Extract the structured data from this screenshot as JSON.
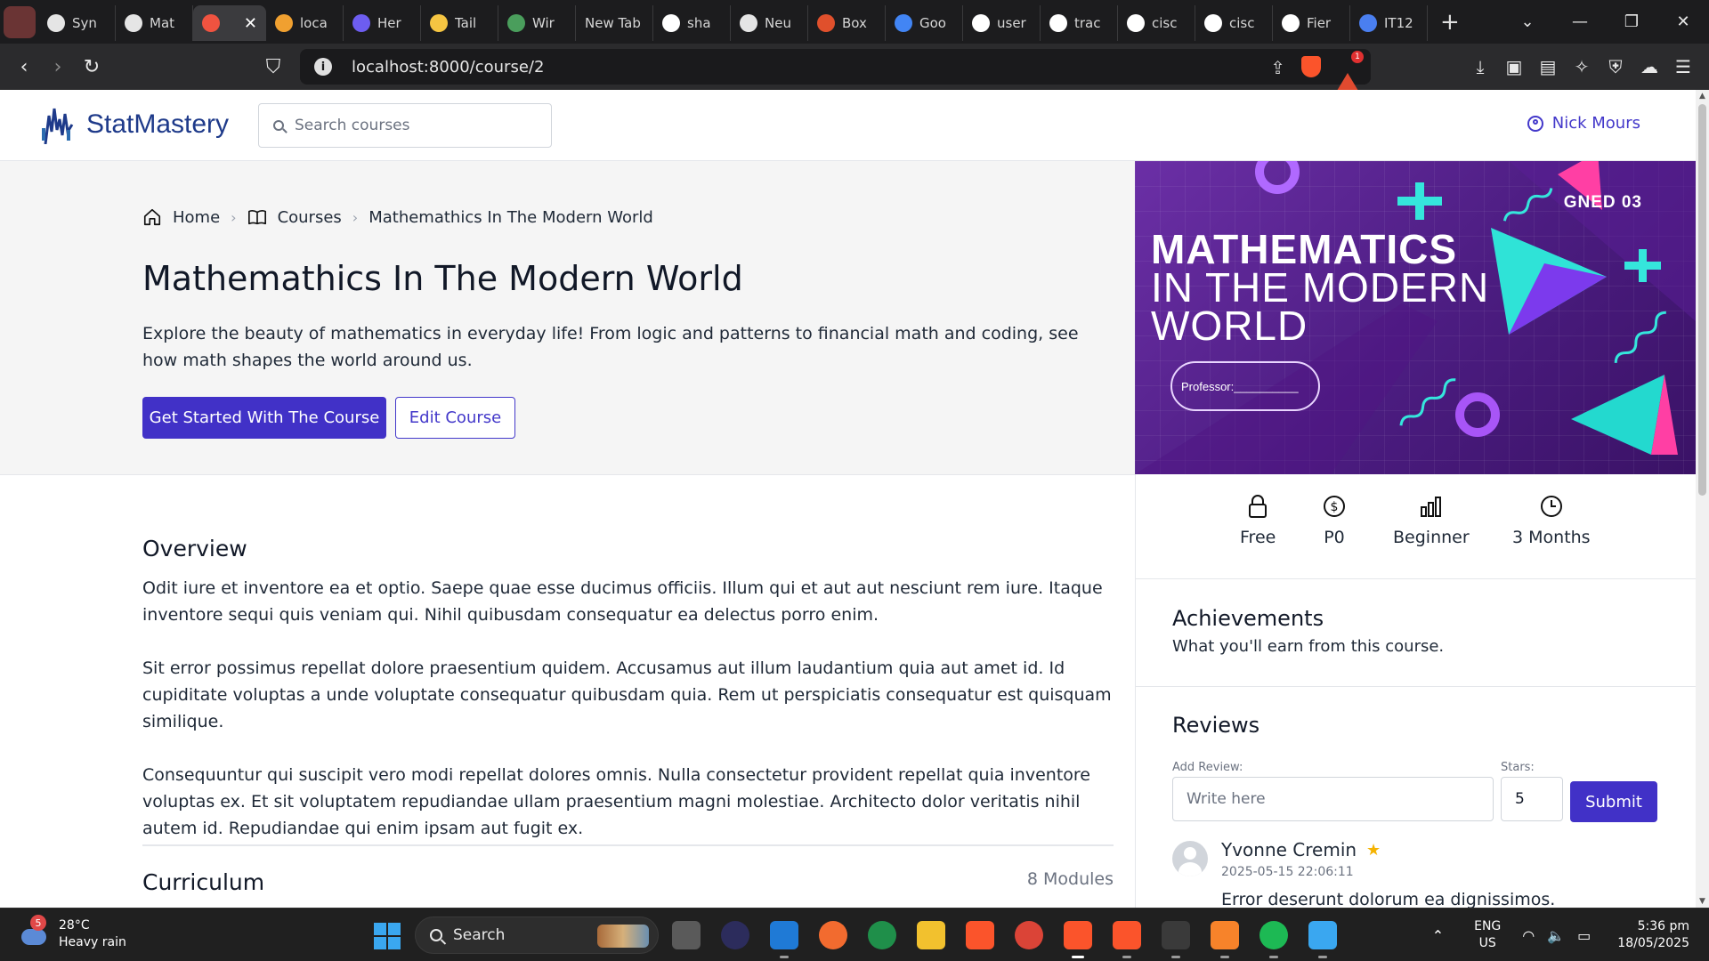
{
  "browser": {
    "tabs": [
      {
        "title": "Syn",
        "icon": "openai-icon",
        "color": "#e5e5e5"
      },
      {
        "title": "Mat",
        "icon": "openai-icon",
        "color": "#e5e5e5"
      },
      {
        "title": "",
        "icon": "laravel-icon",
        "color": "#f05340",
        "active": true
      },
      {
        "title": "loca",
        "icon": "xampp-icon",
        "color": "#f0a030"
      },
      {
        "title": "Her",
        "icon": "shield-icon",
        "color": "#6d5df0"
      },
      {
        "title": "Tail",
        "icon": "emoji-icon",
        "color": "#f5c542"
      },
      {
        "title": "Wir",
        "icon": "globe-icon",
        "color": "#4a9e5c"
      },
      {
        "title": "New Tab",
        "icon": "",
        "color": ""
      },
      {
        "title": "sha",
        "icon": "google-icon",
        "color": "#ffffff"
      },
      {
        "title": "Neu",
        "icon": "openai-icon",
        "color": "#e5e5e5"
      },
      {
        "title": "Box",
        "icon": "box-icon",
        "color": "#e0502c"
      },
      {
        "title": "Goo",
        "icon": "google-calendar-icon",
        "color": "#4285f4"
      },
      {
        "title": "user",
        "icon": "google-icon",
        "color": "#ffffff"
      },
      {
        "title": "trac",
        "icon": "google-icon",
        "color": "#ffffff"
      },
      {
        "title": "cisc",
        "icon": "google-icon",
        "color": "#ffffff"
      },
      {
        "title": "cisc",
        "icon": "google-icon",
        "color": "#ffffff"
      },
      {
        "title": "Fier",
        "icon": "github-icon",
        "color": "#ffffff"
      },
      {
        "title": "IT12",
        "icon": "docs-icon",
        "color": "#4a7ff0"
      }
    ],
    "url": "localhost:8000/course/2",
    "rewards_badge": "1"
  },
  "header": {
    "brand": "StatMastery",
    "search_placeholder": "Search courses",
    "user_name": "Nick Mours"
  },
  "breadcrumb": {
    "home": "Home",
    "courses": "Courses",
    "current": "Mathemathics In The Modern World"
  },
  "course": {
    "title": "Mathemathics In The Modern World",
    "description": "Explore the beauty of mathematics in everyday life! From logic and patterns to financial math and coding, see how math shapes the world around us.",
    "primary_button": "Get Started With The Course",
    "edit_button": "Edit Course",
    "cover": {
      "code": "GNED 03",
      "line1": "MATHEMATICS",
      "line2": "IN THE MODERN",
      "line3": "WORLD",
      "professor": "Professor:__________"
    },
    "stats": {
      "access": "Free",
      "price": "P0",
      "level": "Beginner",
      "duration": "3 Months"
    }
  },
  "overview": {
    "heading": "Overview",
    "paragraphs": [
      "Odit iure et inventore ea et optio. Saepe quae esse ducimus officiis. Illum qui et aut aut nesciunt rem iure. Itaque inventore sequi quis veniam qui. Nihil quibusdam consequatur ea delectus porro enim.",
      "Sit error possimus repellat dolore praesentium quidem. Accusamus aut illum laudantium quia aut amet id. Id cupiditate voluptas a unde voluptate consequatur quibusdam quia. Rem ut perspiciatis consequatur est quisquam similique.",
      "Consequuntur qui suscipit vero modi repellat dolores omnis. Nulla consectetur provident repellat quia inventore voluptas ex. Et sit voluptatem repudiandae ullam praesentium magni molestiae. Architecto dolor veritatis nihil autem id. Repudiandae qui enim ipsam aut fugit ex."
    ]
  },
  "curriculum": {
    "heading": "Curriculum",
    "modules": "8 Modules"
  },
  "achievements": {
    "heading": "Achievements",
    "subtitle": "What you'll earn from this course."
  },
  "reviews": {
    "heading": "Reviews",
    "add_label": "Add Review:",
    "stars_label": "Stars:",
    "placeholder": "Write here",
    "stars_value": "5",
    "submit": "Submit",
    "items": [
      {
        "name": "Yvonne Cremin",
        "date": "2025-05-15 22:06:11",
        "text": "Error deserunt dolorum ea dignissimos.",
        "stars": 1
      }
    ]
  },
  "taskbar": {
    "weather_temp": "28°C",
    "weather_desc": "Heavy rain",
    "weather_badge": "5",
    "search": "Search",
    "lang1": "ENG",
    "lang2": "US",
    "time": "5:36 pm",
    "date": "18/05/2025"
  },
  "colors": {
    "accent": "#4131c7",
    "brand": "#1e3a8a",
    "star": "#f5b301"
  }
}
